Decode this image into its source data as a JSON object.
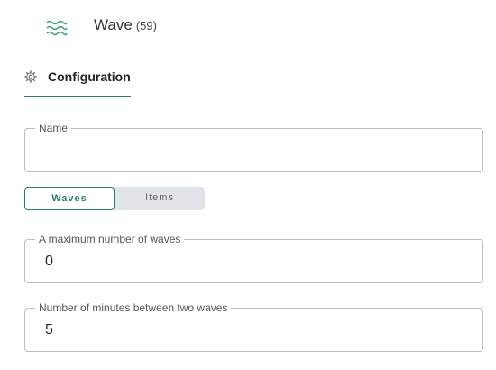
{
  "header": {
    "icon": "wave-icon",
    "title": "Wave",
    "count": "(59)"
  },
  "tabs": [
    {
      "label": "Configuration",
      "icon": "gear-icon",
      "active": true
    }
  ],
  "form": {
    "name": {
      "label": "Name",
      "value": ""
    },
    "mode_toggle": {
      "options": [
        "Waves",
        "Items"
      ],
      "selected": "Waves"
    },
    "max_waves": {
      "label": "A maximum number of waves",
      "value": "0"
    },
    "minutes_between": {
      "label": "Number of minutes between two waves",
      "value": "5"
    }
  },
  "colors": {
    "accent": "#2f7d6d",
    "icon_green": "#3aa36b",
    "border": "#bdbdbd",
    "toggle_bg": "#e1e4e8"
  }
}
